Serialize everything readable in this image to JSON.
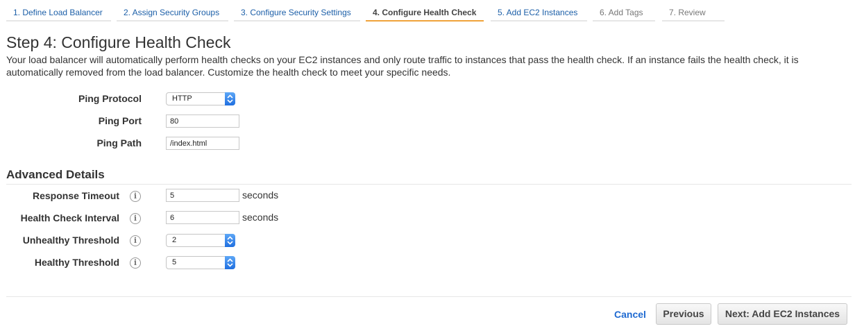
{
  "wizard": {
    "steps": [
      {
        "label": "1. Define Load Balancer"
      },
      {
        "label": "2. Assign Security Groups"
      },
      {
        "label": "3. Configure Security Settings"
      },
      {
        "label": "4. Configure Health Check"
      },
      {
        "label": "5. Add EC2 Instances"
      },
      {
        "label": "6. Add Tags"
      },
      {
        "label": "7. Review"
      }
    ],
    "active_step": 4
  },
  "page": {
    "title": "Step 4: Configure Health Check",
    "description": "Your load balancer will automatically perform health checks on your EC2 instances and only route traffic to instances that pass the health check. If an instance fails the health check, it is automatically removed from the load balancer. Customize the health check to meet your specific needs."
  },
  "ping": {
    "protocol_label": "Ping Protocol",
    "protocol_value": "HTTP",
    "port_label": "Ping Port",
    "port_value": "80",
    "path_label": "Ping Path",
    "path_value": "/index.html"
  },
  "advanced": {
    "heading": "Advanced Details",
    "response_timeout_label": "Response Timeout",
    "response_timeout_value": "5",
    "interval_label": "Health Check Interval",
    "interval_value": "6",
    "unit": "seconds",
    "unhealthy_label": "Unhealthy Threshold",
    "unhealthy_value": "2",
    "healthy_label": "Healthy Threshold",
    "healthy_value": "5",
    "info_glyph": "i"
  },
  "footer": {
    "cancel_label": "Cancel",
    "previous_label": "Previous",
    "next_label": "Next: Add EC2 Instances"
  },
  "colors": {
    "link": "#1c5fa8",
    "active_tab_underline": "#f0a33a",
    "select_arrow": "#1f6fe0"
  }
}
